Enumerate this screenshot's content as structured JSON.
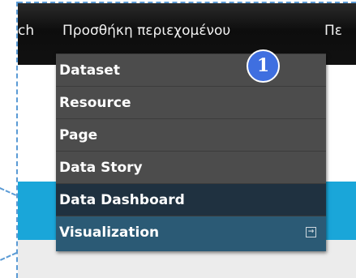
{
  "navbar": {
    "items": [
      {
        "label": "ch"
      },
      {
        "label": "Προσθήκη περιεχομένου"
      },
      {
        "label": "Πε"
      }
    ]
  },
  "dropdown": {
    "items": [
      {
        "label": "Dataset"
      },
      {
        "label": "Resource"
      },
      {
        "label": "Page"
      },
      {
        "label": "Data Story"
      },
      {
        "label": "Data Dashboard"
      },
      {
        "label": "Visualization",
        "has_submenu": true
      }
    ]
  },
  "annotation": {
    "badge_number": "1"
  },
  "colors": {
    "navbar": "#111111",
    "menu": "#4c4c4c",
    "menu_hover": "#1f3140",
    "accent_band": "#1aa6d9",
    "badge": "#3f6fe0",
    "callout_dash": "#5b9bd5"
  }
}
